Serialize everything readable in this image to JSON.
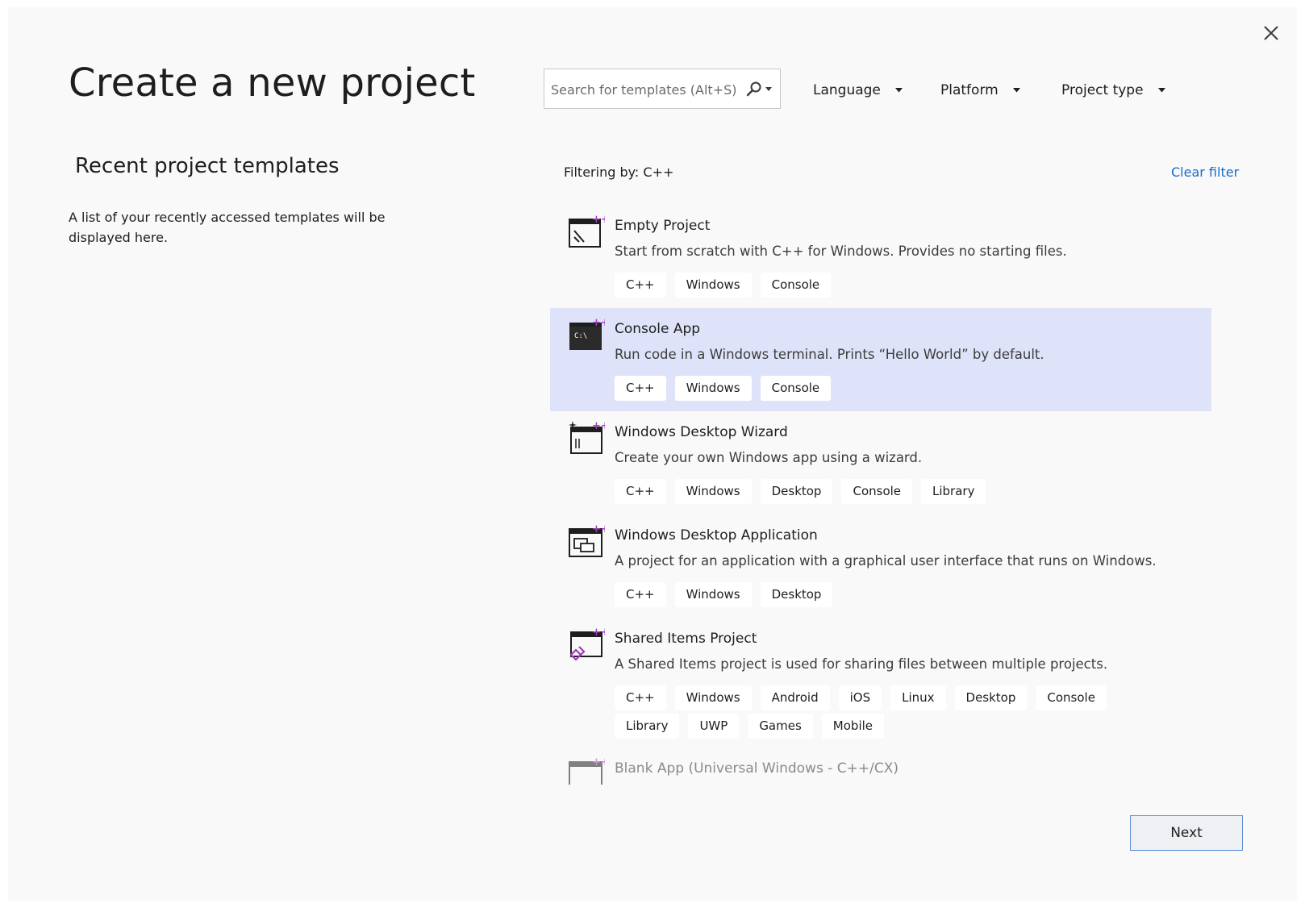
{
  "header": {
    "title": "Create a new project",
    "close_icon": "close-icon"
  },
  "recent": {
    "title": "Recent project templates",
    "description": "A list of your recently accessed templates will be displayed here."
  },
  "search": {
    "placeholder": "Search for templates (Alt+S)",
    "value": "",
    "icon": "search-icon"
  },
  "filters": {
    "language": "Language",
    "platform": "Platform",
    "project_type": "Project type"
  },
  "filter_status": {
    "label": "Filtering by: C++",
    "clear_label": "Clear filter"
  },
  "accent_color": "#1b6ac9",
  "selected_color": "#dfe3f9",
  "templates": [
    {
      "name": "Empty Project",
      "description": "Start from scratch with C++ for Windows. Provides no starting files.",
      "icon": "empty-project-icon",
      "tags": [
        "C++",
        "Windows",
        "Console"
      ]
    },
    {
      "name": "Console App",
      "description": "Run code in a Windows terminal. Prints “Hello World” by default.",
      "icon": "console-app-icon",
      "selected": true,
      "tags": [
        "C++",
        "Windows",
        "Console"
      ]
    },
    {
      "name": "Windows Desktop Wizard",
      "description": "Create your own Windows app using a wizard.",
      "icon": "wizard-icon",
      "tags": [
        "C++",
        "Windows",
        "Desktop",
        "Console",
        "Library"
      ]
    },
    {
      "name": "Windows Desktop Application",
      "description": "A project for an application with a graphical user interface that runs on Windows.",
      "icon": "desktop-app-icon",
      "tags": [
        "C++",
        "Windows",
        "Desktop"
      ]
    },
    {
      "name": "Shared Items Project",
      "description": "A Shared Items project is used for sharing files between multiple projects.",
      "icon": "shared-items-icon",
      "tags": [
        "C++",
        "Windows",
        "Android",
        "iOS",
        "Linux",
        "Desktop",
        "Console",
        "Library",
        "UWP",
        "Games",
        "Mobile"
      ]
    },
    {
      "name": "Blank App (Universal Windows - C++/CX)",
      "description": "",
      "icon": "blank-app-icon",
      "tags": []
    }
  ],
  "footer": {
    "next_label": "Next"
  }
}
